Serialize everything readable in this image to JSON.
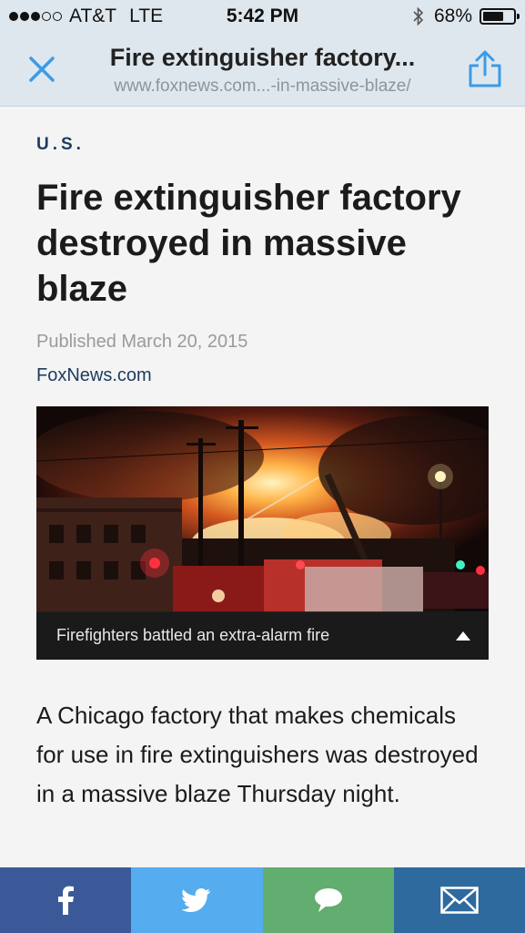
{
  "status_bar": {
    "carrier": "AT&T",
    "network": "LTE",
    "time": "5:42 PM",
    "battery_text": "68%",
    "battery_level": 0.68,
    "signal_full": 3,
    "signal_total": 5
  },
  "nav": {
    "title": "Fire extinguisher factory...",
    "url": "www.foxnews.com...-in-massive-blaze/",
    "close_icon": "close-icon",
    "share_icon": "share-icon",
    "accent_color": "#3b9be8"
  },
  "article": {
    "section": "U.S.",
    "headline": "Fire extinguisher factory destroyed in massive blaze",
    "published": "Published March 20, 2015",
    "source": "FoxNews.com",
    "photo_caption": "Firefighters battled an extra-alarm fire",
    "body": "A Chicago factory that makes chemicals for use in fire extinguishers was destroyed in a massive blaze Thursday night."
  },
  "share_bar": {
    "buttons": [
      {
        "icon": "facebook-icon",
        "color": "#3b5998"
      },
      {
        "icon": "twitter-icon",
        "color": "#55acee"
      },
      {
        "icon": "comment-icon",
        "color": "#62ad70"
      },
      {
        "icon": "email-icon",
        "color": "#2e6a9e"
      }
    ]
  }
}
